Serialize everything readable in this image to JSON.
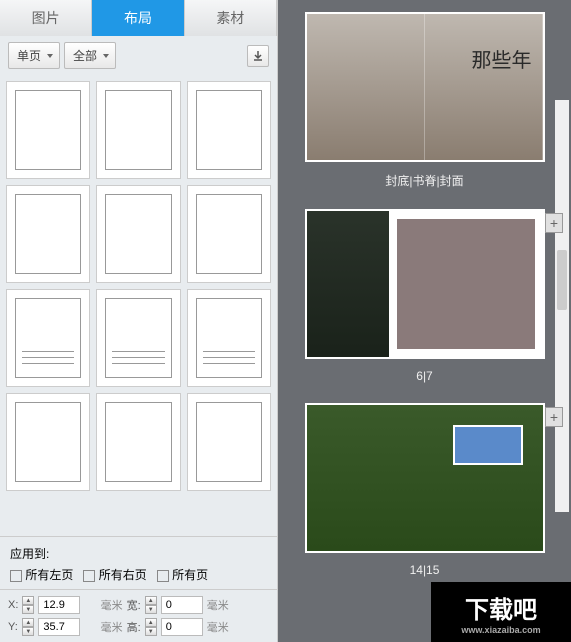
{
  "tabs": {
    "tab1": "图片",
    "tab2": "布局",
    "tab3": "素材"
  },
  "filters": {
    "pageType": "单页",
    "category": "全部"
  },
  "apply": {
    "label": "应用到:",
    "allLeft": "所有左页",
    "allRight": "所有右页",
    "allPages": "所有页"
  },
  "coords": {
    "xLabel": "X:",
    "xValue": "12.9",
    "yLabel": "Y:",
    "yValue": "35.7",
    "wLabel": "宽:",
    "wValue": "0",
    "hLabel": "高:",
    "hValue": "0",
    "unit": "毫米"
  },
  "previews": [
    {
      "label": "封底|书脊|封面",
      "logo": "那些年"
    },
    {
      "label": "6|7"
    },
    {
      "label": "14|15"
    }
  ],
  "watermark": {
    "text": "下载吧",
    "url": "www.xiazaiba.com"
  }
}
